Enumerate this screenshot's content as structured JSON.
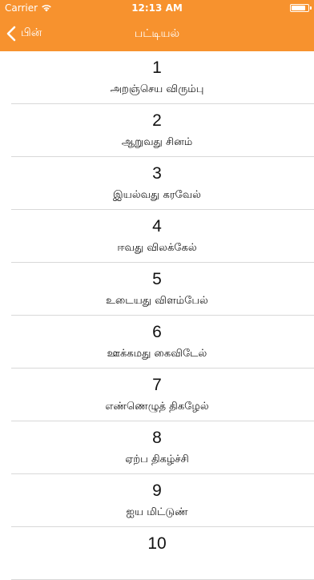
{
  "status_bar": {
    "carrier": "Carrier",
    "time": "12:13 AM"
  },
  "nav": {
    "back_label": "பின்",
    "title": "பட்டியல்"
  },
  "items": [
    {
      "number": "1",
      "title": "அறஞ்செய விரும்பு"
    },
    {
      "number": "2",
      "title": "ஆறுவது சினம்"
    },
    {
      "number": "3",
      "title": "இயல்வது கரவேல்"
    },
    {
      "number": "4",
      "title": "ஈவது விலக்கேல்"
    },
    {
      "number": "5",
      "title": "உடையது விளம்பேல்"
    },
    {
      "number": "6",
      "title": "ஊக்கமது கைவிடேல்"
    },
    {
      "number": "7",
      "title": "எண்ணெழுத் திகழேல்"
    },
    {
      "number": "8",
      "title": "ஏற்ப திகழ்ச்சி"
    },
    {
      "number": "9",
      "title": "ஐய மிட்டுண்"
    },
    {
      "number": "10",
      "title": ""
    }
  ],
  "colors": {
    "accent": "#f7922e"
  }
}
